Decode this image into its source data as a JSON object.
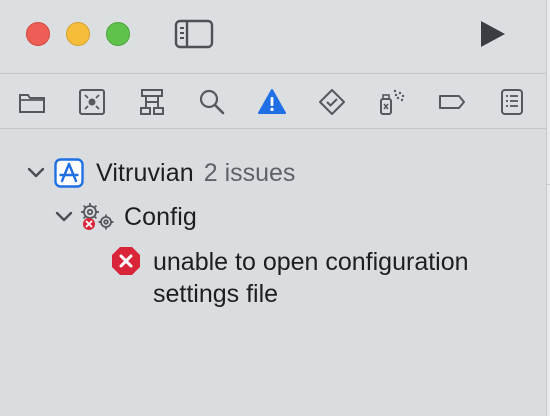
{
  "window": {
    "controls": [
      "close",
      "minimize",
      "zoom"
    ],
    "toolbar_icons": [
      "sidebar-toggle-icon",
      "play-icon"
    ]
  },
  "navigator": {
    "active_tab": "issue-navigator",
    "tabs": [
      "folder-icon",
      "source-control-icon",
      "hierarchy-icon",
      "search-icon",
      "warning-icon",
      "test-icon",
      "debug-icon",
      "breakpoint-icon",
      "report-icon"
    ]
  },
  "issues": {
    "project": {
      "name": "Vitruvian",
      "count": "2 issues",
      "group": {
        "name": "Config",
        "items": [
          {
            "type": "error",
            "message": "unable to open configuration settings file"
          }
        ]
      }
    }
  },
  "colors": {
    "accent": "#1f6fe5",
    "error": "#d8253a",
    "close": "#ee5e56",
    "minimize": "#f5bd3a",
    "zoom": "#5fc24a"
  }
}
